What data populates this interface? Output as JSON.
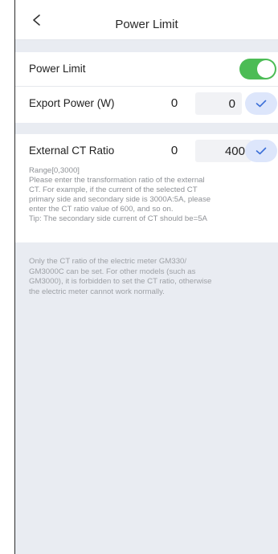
{
  "header": {
    "title": "Power Limit",
    "back_icon": "chevron-left-icon"
  },
  "power_limit": {
    "label": "Power Limit",
    "enabled": true,
    "toggle_color": "#4cbc55"
  },
  "export_power": {
    "label": "Export Power (W)",
    "current_value": "0",
    "input_value": "0",
    "confirm_icon": "checkmark-icon"
  },
  "external_ct": {
    "label": "External CT Ratio",
    "current_value": "0",
    "input_value": "400",
    "confirm_icon": "checkmark-icon",
    "help_lines": [
      "Range[0,3000]",
      "Please enter the transformation ratio of the external",
      "CT. For example, if the current of the selected CT",
      "primary side and secondary side is 3000A:5A, please",
      "enter the CT ratio value of 600, and so on.",
      "Tip: The secondary side current of CT should be=5A"
    ]
  },
  "footnote_lines": [
    "Only the CT ratio of the electric meter GM330/",
    "GM3000C can be set. For other models (such as",
    "GM3000), it is forbidden to set the CT ratio, otherwise",
    "the electric meter cannot work normally."
  ],
  "colors": {
    "accent_blue": "#3b6fd8",
    "confirm_bg": "#dde6fb",
    "page_bg": "#e9ecf2"
  }
}
